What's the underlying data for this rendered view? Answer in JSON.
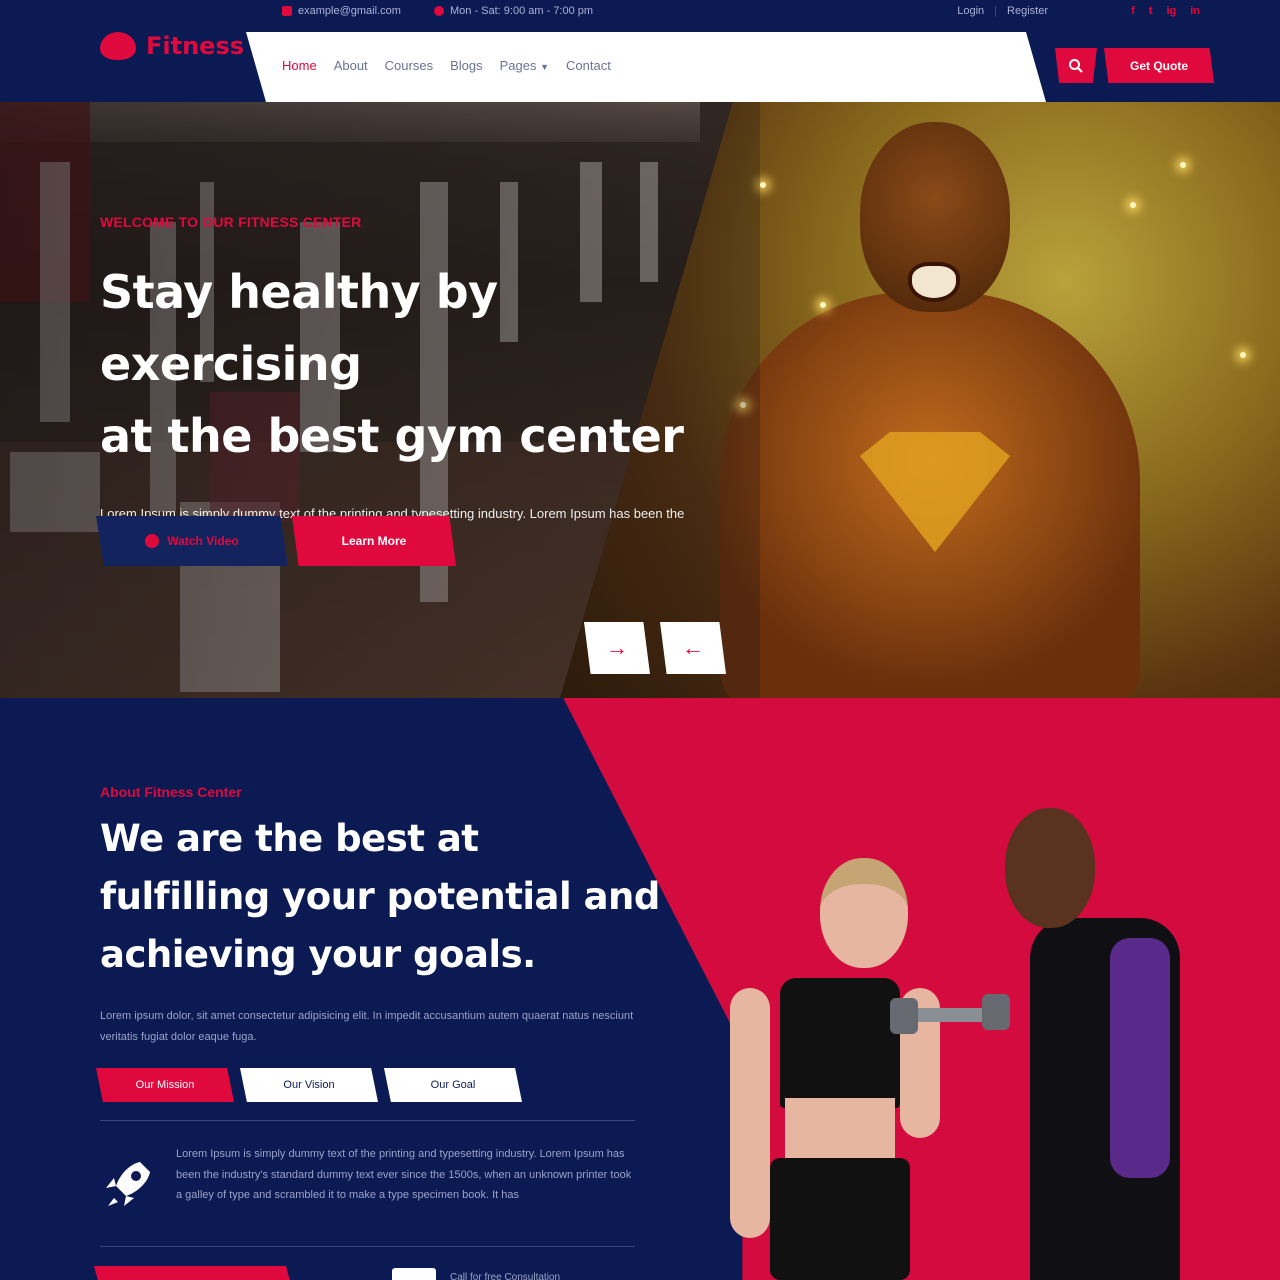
{
  "topbar": {
    "email": "example@gmail.com",
    "hours": "Mon - Sat: 9:00 am - 7:00 pm",
    "login": "Login",
    "register": "Register",
    "socials": [
      "f",
      "t",
      "ig",
      "in"
    ]
  },
  "brand": {
    "name": "Fitness"
  },
  "nav": {
    "items": [
      "Home",
      "About",
      "Courses",
      "Blogs",
      "Pages",
      "Contact"
    ],
    "active": "Home"
  },
  "header": {
    "quote_label": "Get Quote",
    "search_icon": "search-icon"
  },
  "hero": {
    "kicker": "WELCOME TO OUR FITNESS CENTER",
    "title_line1": "Stay healthy by exercising",
    "title_line2": "at the best gym center",
    "description": "Lorem Ipsum is simply dummy text of the printing and typesetting industry. Lorem Ipsum has been the industry's standard dummy...",
    "watch_label": "Watch Video",
    "learn_label": "Learn More",
    "next_arrow": "→",
    "prev_arrow": "←"
  },
  "about": {
    "kicker": "About Fitness Center",
    "title": "We are the best at fulfilling your potential and achieving your goals.",
    "description": "Lorem ipsum dolor, sit amet consectetur adipisicing elit. In impedit accusantium autem quaerat natus nesciunt veritatis fugiat dolor eaque fuga.",
    "tabs": [
      "Our Mission",
      "Our Vision",
      "Our Goal"
    ],
    "feature_text": "Lorem Ipsum is simply dummy text of the printing and typesetting industry. Lorem Ipsum has been the industry's standard dummy text ever since the 1500s, when an unknown printer took a galley of type and scrambled it to make a type specimen book. It has",
    "bottom_text": "Call for free Consultation"
  },
  "colors": {
    "navy": "#0b1a52",
    "accent": "#e0093e",
    "white": "#ffffff"
  }
}
